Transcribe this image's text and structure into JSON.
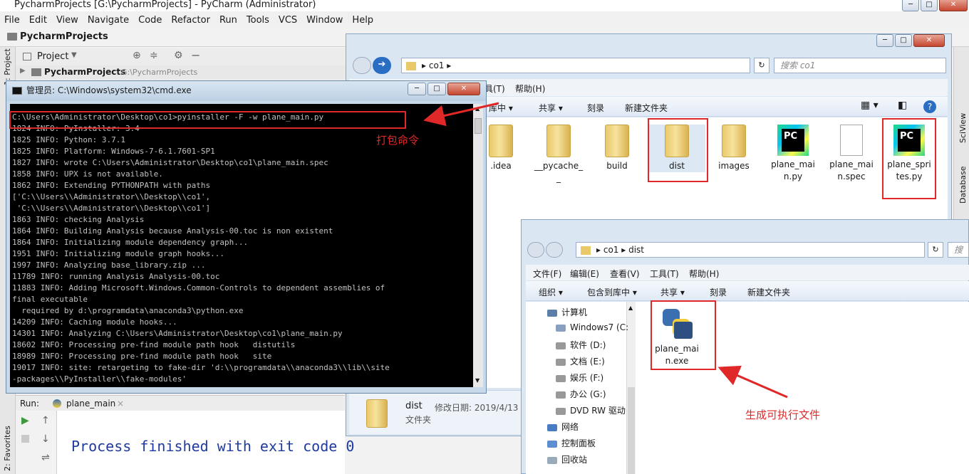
{
  "pycharm": {
    "window_title": "PycharmProjects [G:\\PycharmProjects] - PyCharm (Administrator)",
    "menu": [
      "File",
      "Edit",
      "View",
      "Navigate",
      "Code",
      "Refactor",
      "Run",
      "Tools",
      "VCS",
      "Window",
      "Help"
    ],
    "breadcrumb_project": "PycharmProjects",
    "side_tab_project": "1: Project",
    "side_tab_favorites": "2: Favorites",
    "right_tab_sciview": "SciView",
    "right_tab_database": "Database",
    "project_panel_label": "Project",
    "tree_root_name": "PycharmProjects",
    "tree_root_path": "G:\\PycharmProjects",
    "run": {
      "label": "Run:",
      "tab_name": "plane_main",
      "console_output": "Process finished with exit code 0"
    }
  },
  "cmd": {
    "title": "管理员: C:\\Windows\\system32\\cmd.exe",
    "command_line": "C:\\Users\\Administrator\\Desktop\\co1>pyinstaller -F -w plane_main.py",
    "output_lines": [
      "1824 INFO: PyInstaller: 3.4",
      "1825 INFO: Python: 3.7.1",
      "1825 INFO: Platform: Windows-7-6.1.7601-SP1",
      "1827 INFO: wrote C:\\Users\\Administrator\\Desktop\\co1\\plane_main.spec",
      "1858 INFO: UPX is not available.",
      "1862 INFO: Extending PYTHONPATH with paths",
      "['C:\\\\Users\\\\Administrator\\\\Desktop\\\\co1',",
      " 'C:\\\\Users\\\\Administrator\\\\Desktop\\\\co1']",
      "1863 INFO: checking Analysis",
      "1864 INFO: Building Analysis because Analysis-00.toc is non existent",
      "1864 INFO: Initializing module dependency graph...",
      "1951 INFO: Initializing module graph hooks...",
      "1997 INFO: Analyzing base_library.zip ...",
      "11789 INFO: running Analysis Analysis-00.toc",
      "11883 INFO: Adding Microsoft.Windows.Common-Controls to dependent assemblies of",
      "final executable",
      "  required by d:\\programdata\\anaconda3\\python.exe",
      "14209 INFO: Caching module hooks...",
      "14301 INFO: Analyzing C:\\Users\\Administrator\\Desktop\\co1\\plane_main.py",
      "18602 INFO: Processing pre-find module path hook   distutils",
      "18989 INFO: Processing pre-find module path hook   site",
      "19017 INFO: site: retargeting to fake-dir 'd:\\\\programdata\\\\anaconda3\\\\lib\\\\site",
      "-packages\\\\PyInstaller\\\\fake-modules'"
    ]
  },
  "explorer1": {
    "path_segments": [
      "co1"
    ],
    "search_placeholder": "搜索 co1",
    "menu_partial": [
      "具(T)",
      "帮助(H)"
    ],
    "toolbar": [
      "库中 ▾",
      "共享 ▾",
      "刻录",
      "新建文件夹"
    ],
    "files": [
      {
        "name": ".idea",
        "type": "folder"
      },
      {
        "name": "__pycache__",
        "type": "folder"
      },
      {
        "name": "build",
        "type": "folder"
      },
      {
        "name": "dist",
        "type": "folder"
      },
      {
        "name": "images",
        "type": "folder"
      },
      {
        "name": "plane_main.py",
        "type": "pycharm"
      },
      {
        "name": "plane_main.spec",
        "type": "doc"
      },
      {
        "name": "plane_sprites.py",
        "type": "pycharm"
      }
    ],
    "details": {
      "name": "dist",
      "date_label": "修改日期: 2019/4/13",
      "type": "文件夹"
    }
  },
  "explorer2": {
    "path_segments": [
      "co1",
      "dist"
    ],
    "search_placeholder": "搜索",
    "menu": [
      "文件(F)",
      "编辑(E)",
      "查看(V)",
      "工具(T)",
      "帮助(H)"
    ],
    "toolbar": [
      "组织 ▾",
      "包含到库中 ▾",
      "共享 ▾",
      "刻录",
      "新建文件夹"
    ],
    "nav_tree": [
      "计算机",
      "Windows7 (C:",
      "软件 (D:)",
      "文档 (E:)",
      "娱乐 (F:)",
      "办公 (G:)",
      "DVD RW 驱动",
      "网络",
      "控制面板",
      "回收站"
    ],
    "files": [
      {
        "name": "plane_main.exe",
        "type": "exe"
      }
    ]
  },
  "annotations": {
    "pack_command": "打包命令",
    "generated_exe": "生成可执行文件"
  },
  "colors": {
    "annotation_red": "#e02828",
    "console_blue": "#1f3a9e"
  }
}
